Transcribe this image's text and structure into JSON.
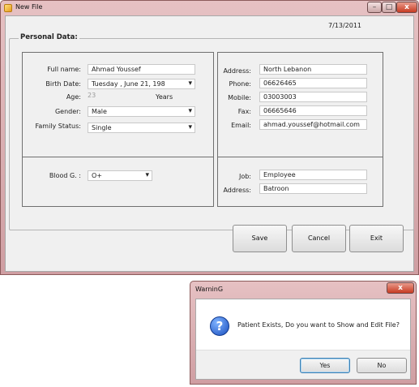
{
  "main_window": {
    "title": "New File",
    "controls": {
      "minimize": "–",
      "maximize": "□",
      "close": "x"
    }
  },
  "form": {
    "date": "7/13/2011",
    "section_title": "Personal Data:",
    "personal": {
      "full_name_label": "Full name:",
      "full_name_value": "Ahmad Youssef",
      "birth_date_label": "Birth Date:",
      "birth_date_value": "Tuesday  ,    June    21, 198",
      "age_label": "Age:",
      "age_value": "23",
      "age_unit": "Years",
      "gender_label": "Gender:",
      "gender_value": "Male",
      "family_status_label": "Family Status:",
      "family_status_value": "Single"
    },
    "contact": {
      "address_label": "Address:",
      "address_value": "North Lebanon",
      "phone_label": "Phone:",
      "phone_value": "06626465",
      "mobile_label": "Mobile:",
      "mobile_value": "03003003",
      "fax_label": "Fax:",
      "fax_value": "06665646",
      "email_label": "Email:",
      "email_value": "ahmad.youssef@hotmail.com"
    },
    "medical": {
      "blood_label": "Blood G. :",
      "blood_value": "O+"
    },
    "work": {
      "job_label": "Job:",
      "job_value": "Employee",
      "address_label": "Address:",
      "address_value": "Batroon"
    },
    "buttons": {
      "save": "Save",
      "cancel": "Cancel",
      "exit": "Exit"
    }
  },
  "dialog": {
    "title": "WarninG",
    "close": "x",
    "icon": "question-icon",
    "message": "Patient Exists, Do you want to Show and Edit File?",
    "yes": "Yes",
    "no": "No"
  }
}
